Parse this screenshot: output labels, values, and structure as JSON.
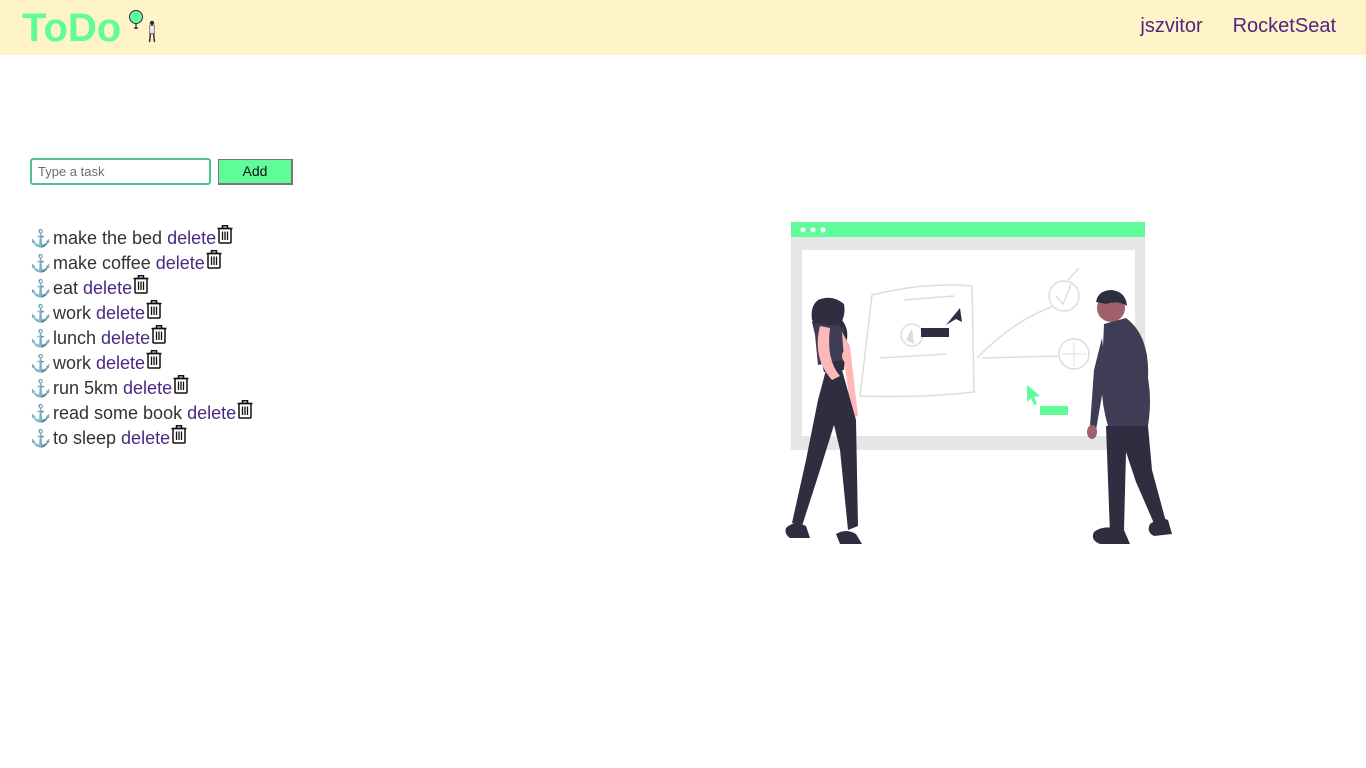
{
  "app": {
    "logo_text": "ToDo",
    "brand_color": "#60fc99",
    "header_bg": "#fff3c8",
    "nav": [
      "jszvitor",
      "RocketSeat"
    ]
  },
  "form": {
    "placeholder": "Type a task",
    "value": "",
    "add_label": "Add"
  },
  "tasks": [
    {
      "icon": "anchor-icon",
      "name": "make the bed",
      "delete_label": "delete"
    },
    {
      "icon": "anchor-icon",
      "name": "make coffee",
      "delete_label": "delete"
    },
    {
      "icon": "anchor-icon",
      "name": "eat",
      "delete_label": "delete"
    },
    {
      "icon": "anchor-icon",
      "name": "work",
      "delete_label": "delete"
    },
    {
      "icon": "anchor-icon",
      "name": "lunch",
      "delete_label": "delete"
    },
    {
      "icon": "anchor-icon",
      "name": "work",
      "delete_label": "delete"
    },
    {
      "icon": "anchor-icon",
      "name": "run 5km",
      "delete_label": "delete"
    },
    {
      "icon": "anchor-icon",
      "name": "read some book",
      "delete_label": "delete"
    },
    {
      "icon": "anchor-icon",
      "name": "to sleep",
      "delete_label": "delete"
    }
  ],
  "colors": {
    "anchor": "#e0367a",
    "link": "#4b2882"
  }
}
